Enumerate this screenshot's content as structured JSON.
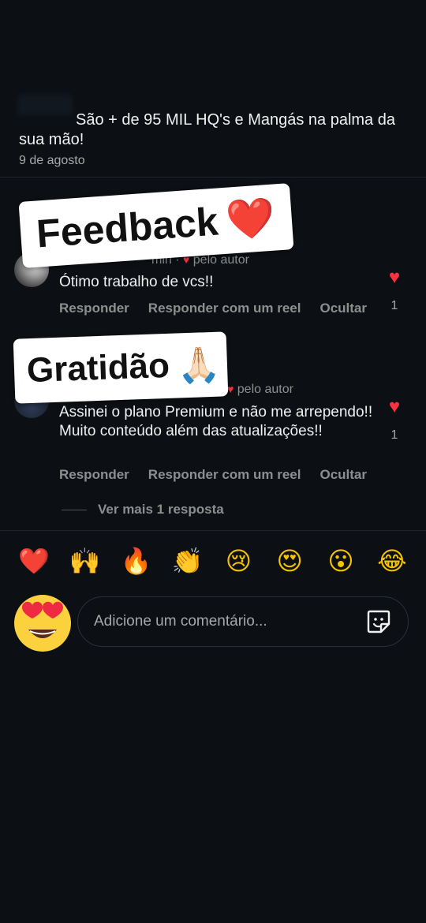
{
  "post": {
    "caption": "São + de 95 MIL HQ's e Mangás na palma da sua mão!",
    "date": "9 de agosto"
  },
  "comments": [
    {
      "meta_time": "min ·",
      "meta_author": "pelo autor",
      "text": "Ótimo trabalho de vcs!!",
      "likes": "1",
      "actions": [
        "Responder",
        "Responder com um reel",
        "Ocultar"
      ]
    },
    {
      "meta_time": "",
      "meta_author": "pelo autor",
      "text": "Assinei o plano Premium e não me arrependo!! Muito conteúdo além das atualizações!!",
      "likes": "1",
      "actions": [
        "Responder",
        "Responder com um reel",
        "Ocultar"
      ],
      "more_replies": "Ver mais 1 resposta"
    }
  ],
  "stickers": {
    "feedback": "Feedback",
    "feedback_emoji": "❤️",
    "gratidao": "Gratidão",
    "gratidao_emoji": "🙏🏻"
  },
  "emoji_bar": [
    "❤️",
    "🙌",
    "🔥",
    "👏",
    "😢",
    "😍",
    "😮",
    "😂"
  ],
  "composer": {
    "placeholder": "Adicione um comentário...",
    "sticker_icon": "sticker-icon",
    "avatar_emoji": "heart-eyes-emoji"
  },
  "colors": {
    "background": "#0c1014",
    "like_red": "#ff3040",
    "muted": "#8e8e8e"
  }
}
